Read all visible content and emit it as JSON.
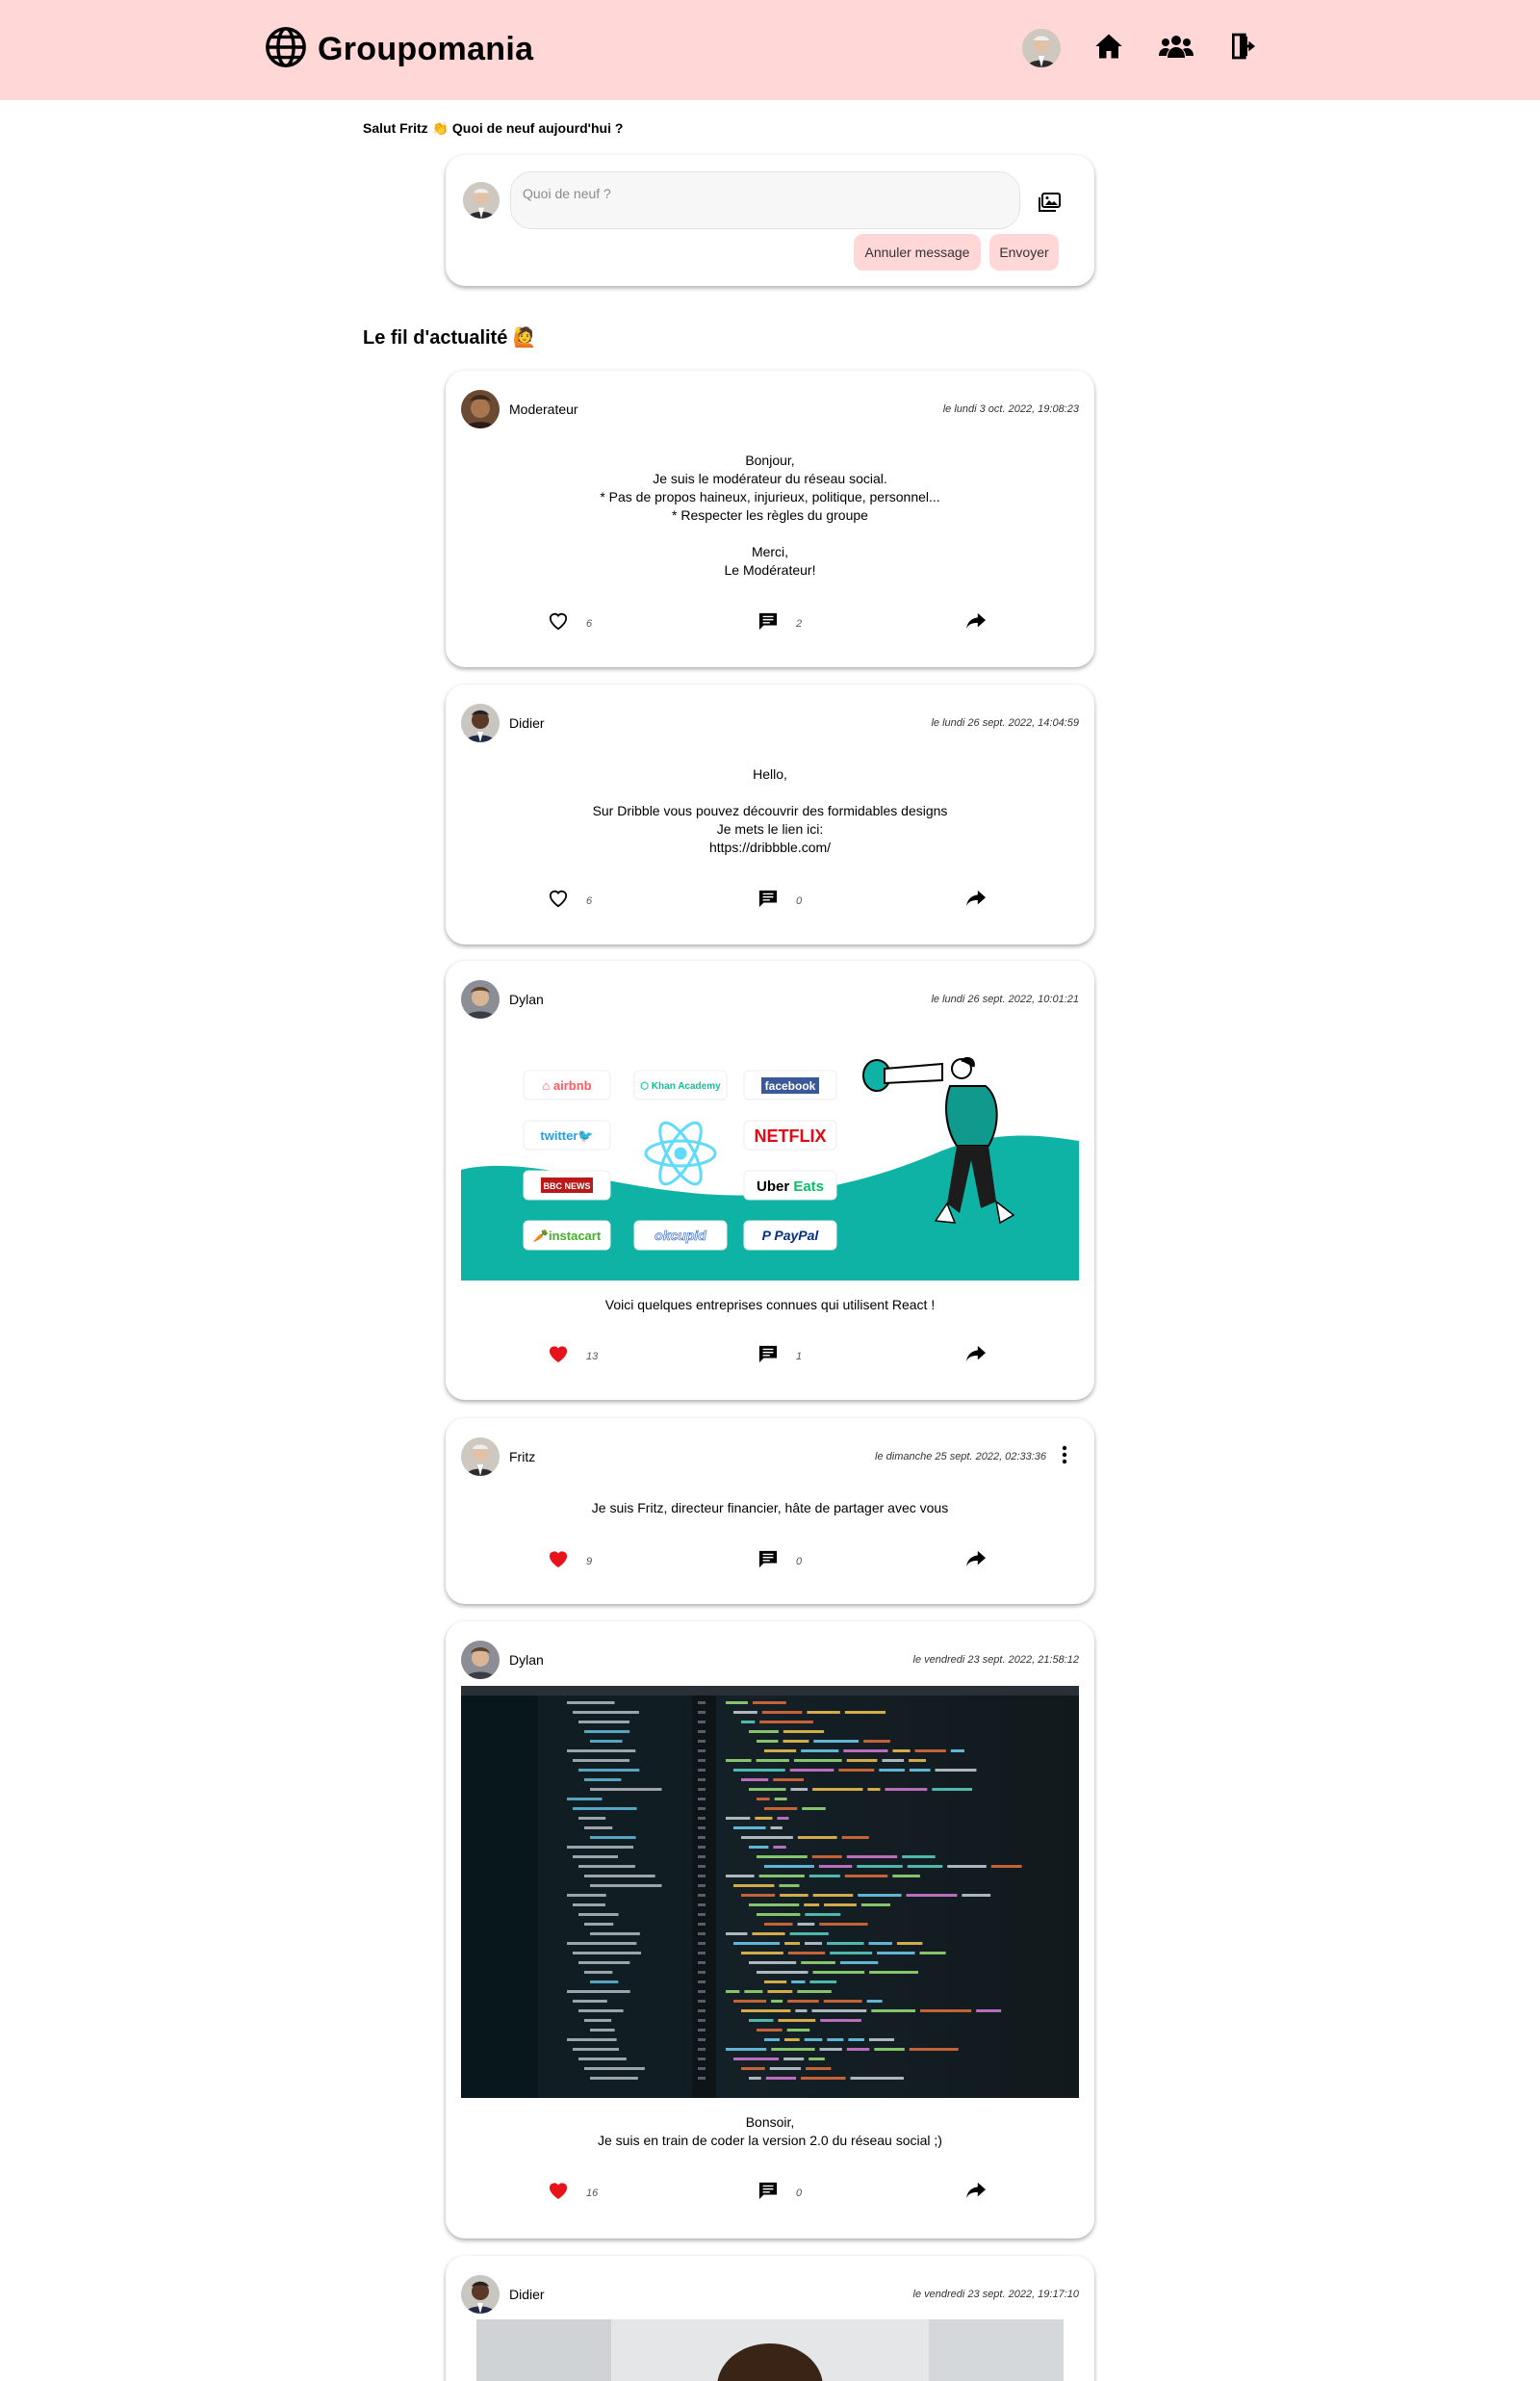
{
  "header": {
    "brand": "Groupomania",
    "nav": [
      {
        "name": "profile-avatar",
        "icon": "user-avatar"
      },
      {
        "name": "home",
        "icon": "home-icon"
      },
      {
        "name": "users",
        "icon": "users-icon"
      },
      {
        "name": "logout",
        "icon": "logout-icon"
      }
    ],
    "background": "#ffd7d7"
  },
  "greeting": "Salut Fritz 👏 Quoi de neuf aujourd'hui ?",
  "composer": {
    "placeholder": "Quoi de neuf ?",
    "cancel_label": "Annuler message",
    "send_label": "Envoyer"
  },
  "feed_title": "Le fil d'actualité 🙋",
  "posts": [
    {
      "author": "Moderateur",
      "date": "le lundi 3 oct. 2022, 19:08:23",
      "body": "Bonjour,\nJe suis le modérateur du réseau social.\n* Pas de propos haineux, injurieux, politique, personnel...\n* Respecter les règles du groupe\n\nMerci,\nLe Modérateur!",
      "likes": "6",
      "liked": false,
      "comments": "2"
    },
    {
      "author": "Didier",
      "date": "le lundi 26 sept. 2022, 14:04:59",
      "body": "Hello,\n\nSur Dribble vous pouvez découvrir des formidables designs\nJe mets le lien ici:\nhttps://dribbble.com/",
      "likes": "6",
      "liked": false,
      "comments": "0"
    },
    {
      "author": "Dylan",
      "date": "le lundi 26 sept. 2022, 10:01:21",
      "body": "Voici quelques entreprises connues qui utilisent React !",
      "likes": "13",
      "liked": true,
      "comments": "1",
      "image_logos": [
        "airbnb",
        "Khan Academy",
        "facebook",
        "twitter",
        "NETFLIX",
        "BBC NEWS",
        "Uber Eats",
        "instacart",
        "okcupid",
        "PayPal"
      ]
    },
    {
      "author": "Fritz",
      "date": "le dimanche 25 sept. 2022, 02:33:36",
      "body": "Je suis Fritz, directeur financier, hâte de partager avec vous",
      "likes": "9",
      "liked": true,
      "comments": "0"
    },
    {
      "author": "Dylan",
      "date": "le vendredi 23 sept. 2022, 21:58:12",
      "body": "Bonsoir,\nJe suis en train de coder la version 2.0 du réseau social ;)",
      "likes": "16",
      "liked": true,
      "comments": "0"
    },
    {
      "author": "Didier",
      "date": "le vendredi 23 sept. 2022, 19:17:10"
    }
  ],
  "colors": {
    "pink": "#ffd7d7",
    "like_red": "#e8121a",
    "teal": "#0fb3a5"
  }
}
